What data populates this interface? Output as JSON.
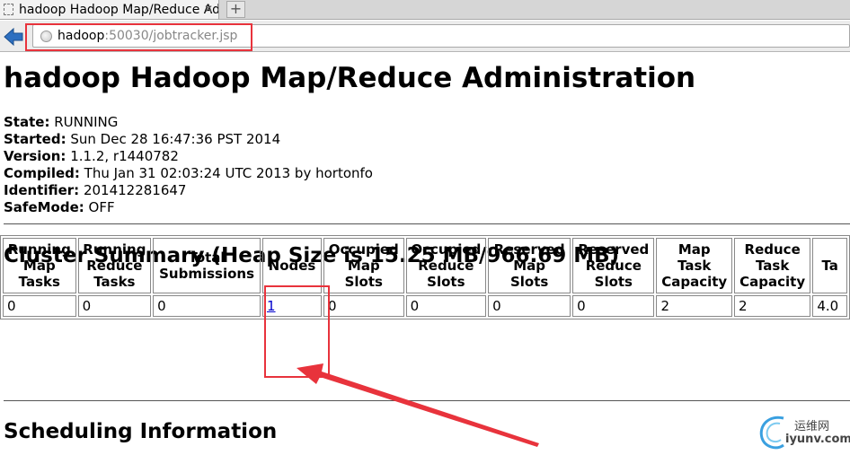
{
  "browser": {
    "tab_title": "hadoop Hadoop Map/Reduce Ad...",
    "tab_close": "✕",
    "new_tab": "+",
    "url_host": "hadoop",
    "url_rest": ":50030/jobtracker.jsp"
  },
  "page": {
    "title": "hadoop Hadoop Map/Reduce Administration",
    "info": [
      {
        "label": "State:",
        "value": "RUNNING"
      },
      {
        "label": "Started:",
        "value": "Sun Dec 28 16:47:36 PST 2014"
      },
      {
        "label": "Version:",
        "value": "1.1.2, r1440782"
      },
      {
        "label": "Compiled:",
        "value": "Thu Jan 31 02:03:24 UTC 2013 by hortonfo"
      },
      {
        "label": "Identifier:",
        "value": "201412281647"
      },
      {
        "label": "SafeMode:",
        "value": "OFF"
      }
    ],
    "cluster_summary_title": "Cluster Summary (Heap Size is 15.25 MB/966.69 MB)",
    "scheduling_title": "Scheduling Information"
  },
  "summary_table": {
    "headers": [
      [
        "Running",
        "Map",
        "Tasks"
      ],
      [
        "Running",
        "Reduce",
        "Tasks"
      ],
      [
        "Total",
        "Submissions"
      ],
      [
        "Nodes"
      ],
      [
        "Occupied",
        "Map",
        "Slots"
      ],
      [
        "Occupied",
        "Reduce",
        "Slots"
      ],
      [
        "Reserved",
        "Map",
        "Slots"
      ],
      [
        "Reserved",
        "Reduce",
        "Slots"
      ],
      [
        "Map",
        "Task",
        "Capacity"
      ],
      [
        "Reduce",
        "Task",
        "Capacity"
      ],
      [
        "Ta"
      ]
    ],
    "row": [
      "0",
      "0",
      "0",
      "1",
      "0",
      "0",
      "0",
      "0",
      "2",
      "2",
      "4.0"
    ]
  },
  "watermark": {
    "cn": "运维网",
    "en": "iyunv.com"
  },
  "colors": {
    "annotation_red": "#e8333c",
    "link_blue": "#0000cc",
    "back_arrow_blue": "#2d6fc0"
  }
}
